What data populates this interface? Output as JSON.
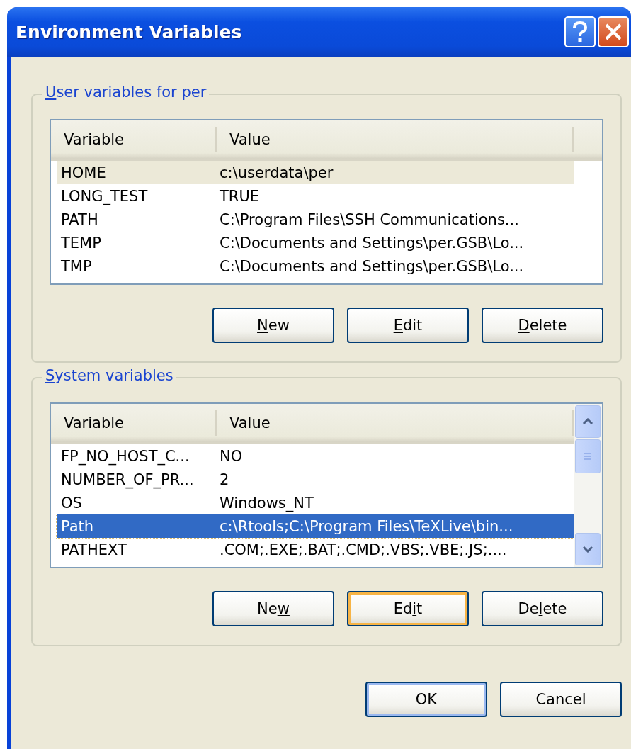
{
  "window": {
    "title": "Environment Variables"
  },
  "groups": [
    {
      "label": {
        "key": "U",
        "after": "ser variables for per"
      },
      "focused": false,
      "scrollbar": false,
      "columns": [
        "Variable",
        "Value"
      ],
      "rows": [
        {
          "cells": [
            "HOME",
            "c:\\userdata\\per"
          ],
          "selected": true
        },
        {
          "cells": [
            "LONG_TEST",
            "TRUE"
          ],
          "selected": false
        },
        {
          "cells": [
            "PATH",
            "C:\\Program Files\\SSH Communications..."
          ],
          "selected": false
        },
        {
          "cells": [
            "TEMP",
            "C:\\Documents and Settings\\per.GSB\\Lo..."
          ],
          "selected": false
        },
        {
          "cells": [
            "TMP",
            "C:\\Documents and Settings\\per.GSB\\Lo..."
          ],
          "selected": false
        }
      ],
      "buttons": [
        {
          "key": "N",
          "after": "ew",
          "hot": false,
          "default": false
        },
        {
          "key": "E",
          "after": "dit",
          "hot": false,
          "default": false
        },
        {
          "key": "D",
          "after": "elete",
          "hot": false,
          "default": false
        }
      ]
    },
    {
      "label": {
        "key": "S",
        "after": "ystem variables"
      },
      "focused": true,
      "scrollbar": true,
      "columns": [
        "Variable",
        "Value"
      ],
      "rows": [
        {
          "cells": [
            "FP_NO_HOST_C...",
            "NO"
          ],
          "selected": false
        },
        {
          "cells": [
            "NUMBER_OF_PR...",
            "2"
          ],
          "selected": false
        },
        {
          "cells": [
            "OS",
            "Windows_NT"
          ],
          "selected": false
        },
        {
          "cells": [
            "Path",
            "c:\\Rtools;C:\\Program Files\\TeXLive\\bin..."
          ],
          "selected": true
        },
        {
          "cells": [
            "PATHEXT",
            ".COM;.EXE;.BAT;.CMD;.VBS;.VBE;.JS;...."
          ],
          "selected": false
        }
      ],
      "buttons": [
        {
          "before": "Ne",
          "key": "w",
          "hot": false,
          "default": false
        },
        {
          "before": "Ed",
          "key": "i",
          "after": "t",
          "hot": true,
          "default": false
        },
        {
          "before": "De",
          "key": "l",
          "after": "ete",
          "hot": false,
          "default": false
        }
      ]
    }
  ],
  "footer_buttons": [
    {
      "before": "OK",
      "hot": false,
      "default": true
    },
    {
      "before": "Cancel",
      "hot": false,
      "default": false
    }
  ]
}
